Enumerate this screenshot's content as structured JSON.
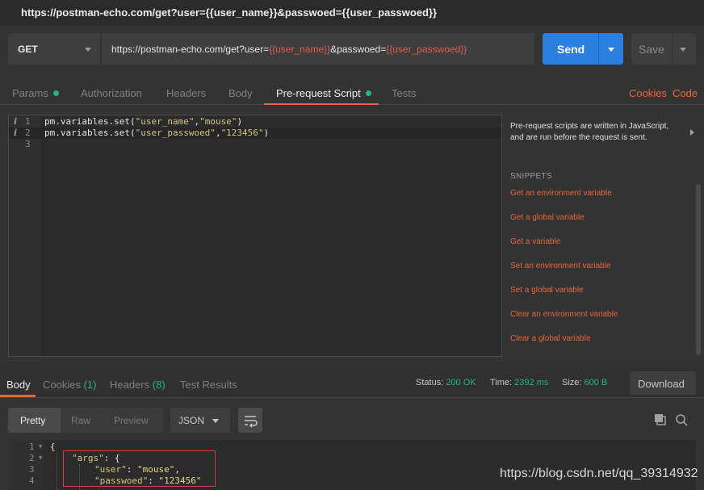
{
  "window": {
    "title": "https://postman-echo.com/get?user={{user_name}}&passwoed={{user_passwoed}}"
  },
  "request": {
    "method": "GET",
    "url_prefix": "https://postman-echo.com/get?user=",
    "url_var1": "{{user_name}}",
    "url_mid": "&passwoed=",
    "url_var2": "{{user_passwoed}}",
    "send_label": "Send",
    "save_label": "Save"
  },
  "request_tabs": {
    "params": "Params",
    "authorization": "Authorization",
    "headers": "Headers",
    "body": "Body",
    "prerequest": "Pre-request Script",
    "tests": "Tests",
    "cookies_link": "Cookies",
    "code_link": "Code"
  },
  "editor": {
    "lines": [
      {
        "num": "1",
        "info": "i",
        "code_a": "pm.variables.set(",
        "str1": "\"user_name\"",
        "comma": ",",
        "str2": "\"mouse\"",
        "end": ")"
      },
      {
        "num": "2",
        "info": "i",
        "code_a": "pm.variables.set(",
        "str1": "\"user_passwoed\"",
        "comma": ",",
        "str2": "\"123456\"",
        "end": ")"
      },
      {
        "num": "3"
      }
    ]
  },
  "snippets_panel": {
    "description": "Pre-request scripts are written in JavaScript, and are run before the request is sent.",
    "heading": "SNIPPETS",
    "items": [
      "Get an environment variable",
      "Get a global variable",
      "Get a variable",
      "Set an environment variable",
      "Set a global variable",
      "Clear an environment variable",
      "Clear a global variable"
    ]
  },
  "response_tabs": {
    "body": "Body",
    "cookies": "Cookies",
    "cookies_count": "(1)",
    "headers": "Headers",
    "headers_count": "(8)",
    "test_results": "Test Results"
  },
  "response_status": {
    "status_label": "Status:",
    "status_value": "200 OK",
    "time_label": "Time:",
    "time_value": "2392 ms",
    "size_label": "Size:",
    "size_value": "600 B",
    "download_label": "Download"
  },
  "view_options": {
    "pretty": "Pretty",
    "raw": "Raw",
    "preview": "Preview",
    "format": "JSON"
  },
  "response_body": {
    "lines": [
      {
        "num": "1",
        "text": "{"
      },
      {
        "num": "2",
        "key": "\"args\"",
        "rest": ": {"
      },
      {
        "num": "3",
        "key": "\"user\"",
        "rest": ": ",
        "val": "\"mouse\"",
        "tail": ","
      },
      {
        "num": "4",
        "key": "\"passwoed\"",
        "rest": ": ",
        "val": "\"123456\""
      }
    ]
  },
  "watermark": "https://blog.csdn.net/qq_39314932",
  "colors": {
    "accent_orange": "#e8663a",
    "send_blue": "#2c7fde",
    "status_green": "#26b47f",
    "variable_red": "#e25a4e"
  }
}
